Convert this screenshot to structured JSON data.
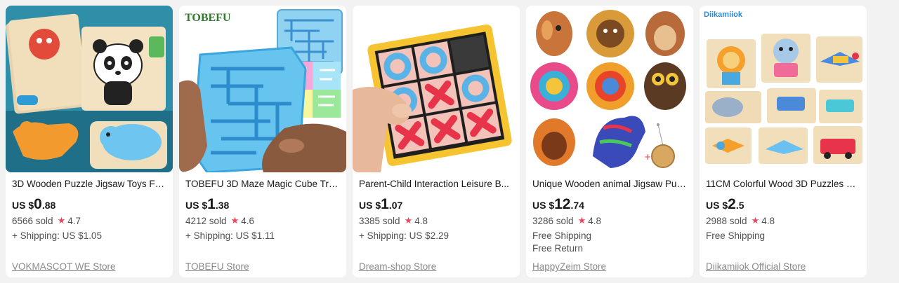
{
  "products": [
    {
      "title": "3D Wooden Puzzle Jigsaw Toys For...",
      "price_currency": "US $",
      "price_int": "0",
      "price_dec": ".88",
      "sold": "6566 sold",
      "rating": "4.7",
      "shipping": [
        "+ Shipping: US $1.05"
      ],
      "store": "VOKMASCOT WE Store"
    },
    {
      "title": "TOBEFU 3D Maze Magic Cube Tran...",
      "image_brand": "TOBEFU",
      "price_currency": "US $",
      "price_int": "1",
      "price_dec": ".38",
      "sold": "4212 sold",
      "rating": "4.6",
      "shipping": [
        "+ Shipping: US $1.11"
      ],
      "store": "TOBEFU Store"
    },
    {
      "title": "Parent-Child Interaction Leisure B...",
      "price_currency": "US $",
      "price_int": "1",
      "price_dec": ".07",
      "sold": "3385 sold",
      "rating": "4.8",
      "shipping": [
        "+ Shipping: US $2.29"
      ],
      "store": "Dream-shop Store"
    },
    {
      "title": "Unique Wooden animal Jigsaw Puz...",
      "price_currency": "US $",
      "price_int": "12",
      "price_dec": ".74",
      "sold": "3286 sold",
      "rating": "4.8",
      "shipping": [
        "Free Shipping",
        "Free Return"
      ],
      "store": "HappyZeim Store"
    },
    {
      "title": "11CM Colorful Wood 3D Puzzles C...",
      "image_brand": "Diikamiiok",
      "price_currency": "US $",
      "price_int": "2",
      "price_dec": ".5",
      "sold": "2988 sold",
      "rating": "4.8",
      "shipping": [
        "Free Shipping"
      ],
      "store": "Diikamiiok Official Store"
    }
  ],
  "colors": {
    "star": "#f0445a",
    "background": "#f2f2f2",
    "card": "#ffffff"
  },
  "icons": {
    "star": "star-icon"
  }
}
